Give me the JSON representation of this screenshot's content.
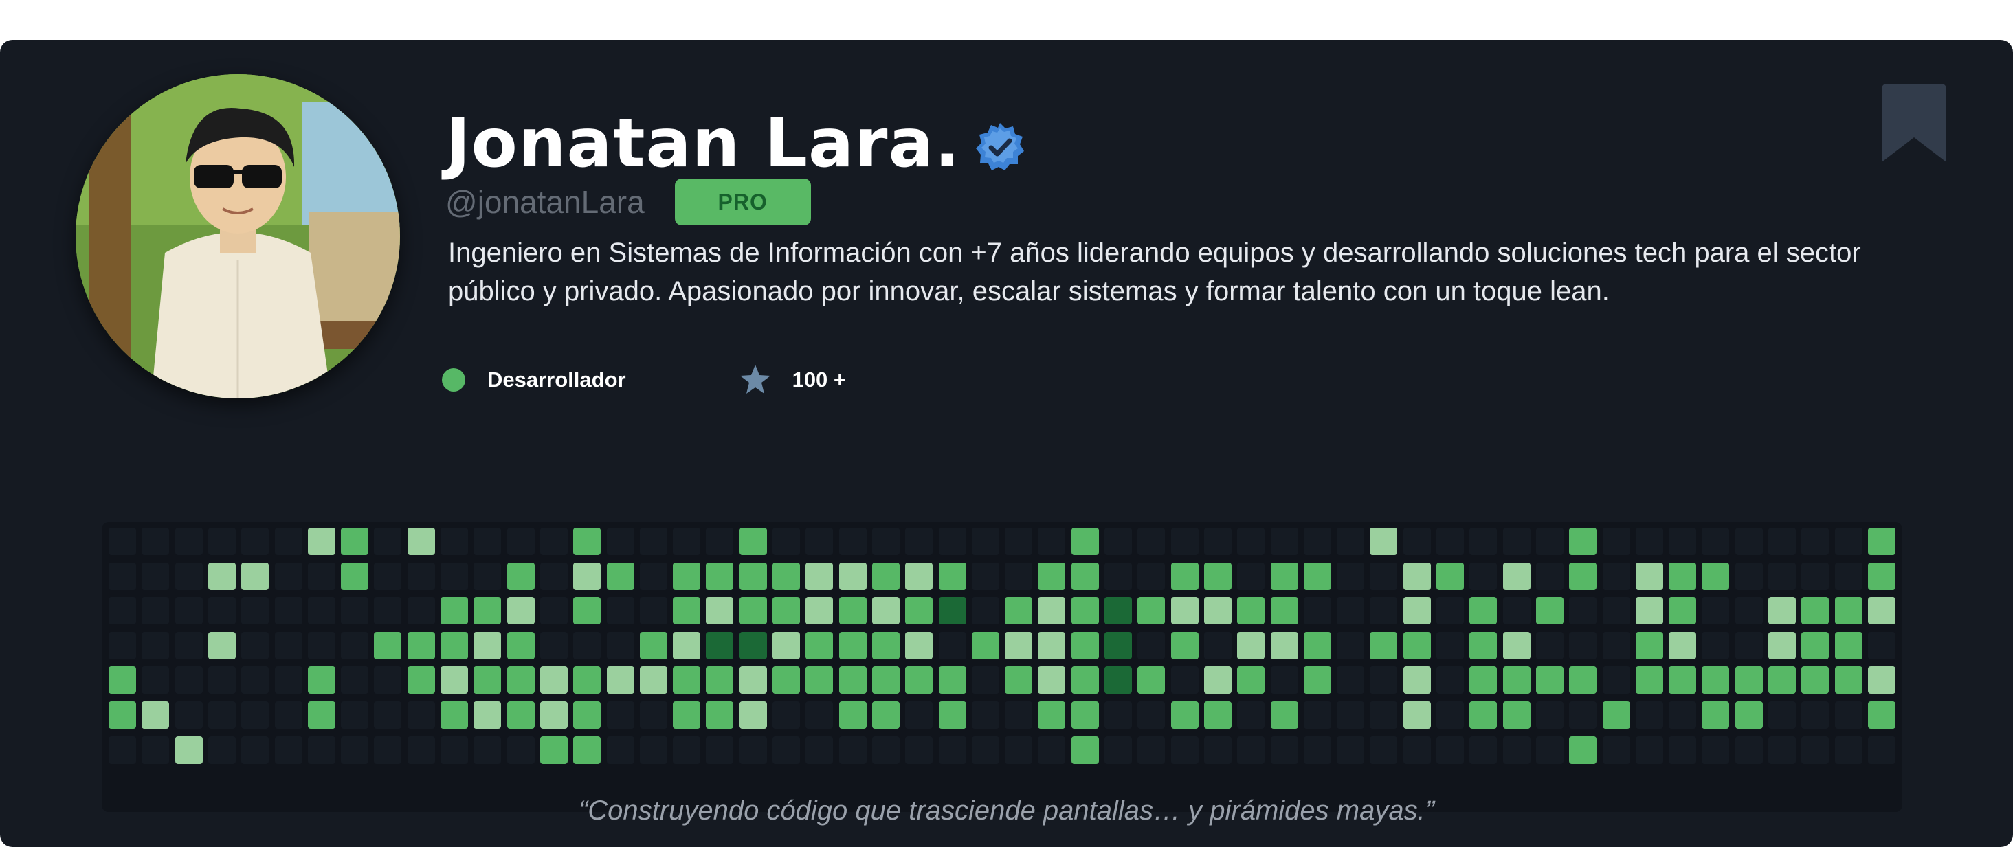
{
  "profile": {
    "name": "Jonatan Lara.",
    "handle": "@jonatanLara",
    "badge": "PRO",
    "bio": "Ingeniero en Sistemas de Información con +7 años liderando equipos y desarrollando soluciones tech para el sector público y privado. Apasionado por innovar, escalar sistemas y formar talento con un toque lean.",
    "role": "Desarrollador",
    "stars": "100 +",
    "quote": "“Construyendo código que trasciende pantallas… y pirámides mayas.”"
  },
  "icons": {
    "verified": "verified-badge-icon",
    "bookmark": "bookmark-icon",
    "status": "status-dot-icon",
    "star": "star-icon"
  },
  "colors": {
    "card_bg": "#151a22",
    "accent_green": "#57b866",
    "pro_bg": "#59b965",
    "pro_text": "#16612c",
    "handle": "#646b75",
    "verified": "#3d83d6",
    "star": "#6c8aa7",
    "bookmark": "#323c4b",
    "contrib_levels": [
      "#151b23",
      "#9bd09e",
      "#57b866",
      "#1b6936"
    ]
  },
  "contributions": {
    "weeks": 54,
    "days": 7,
    "cells": [
      [
        0,
        0,
        0,
        0,
        2,
        2,
        0
      ],
      [
        0,
        0,
        0,
        0,
        0,
        1,
        0
      ],
      [
        0,
        0,
        0,
        0,
        0,
        0,
        1
      ],
      [
        0,
        1,
        0,
        1,
        0,
        0,
        0
      ],
      [
        0,
        1,
        0,
        0,
        0,
        0,
        0
      ],
      [
        0,
        0,
        0,
        0,
        0,
        0,
        0
      ],
      [
        1,
        0,
        0,
        0,
        2,
        2,
        0
      ],
      [
        2,
        2,
        0,
        0,
        0,
        0,
        0
      ],
      [
        0,
        0,
        0,
        2,
        0,
        0,
        0
      ],
      [
        1,
        0,
        0,
        2,
        2,
        0,
        0
      ],
      [
        0,
        0,
        2,
        2,
        1,
        2,
        0
      ],
      [
        0,
        0,
        2,
        1,
        2,
        1,
        0
      ],
      [
        0,
        2,
        1,
        2,
        2,
        2,
        0
      ],
      [
        0,
        0,
        0,
        0,
        1,
        1,
        2
      ],
      [
        2,
        1,
        2,
        0,
        2,
        2,
        2
      ],
      [
        0,
        2,
        0,
        0,
        1,
        0,
        0
      ],
      [
        0,
        0,
        0,
        2,
        1,
        0,
        0
      ],
      [
        0,
        2,
        2,
        1,
        2,
        2,
        0
      ],
      [
        0,
        2,
        1,
        3,
        2,
        2,
        0
      ],
      [
        2,
        2,
        2,
        3,
        1,
        1,
        0
      ],
      [
        0,
        2,
        2,
        1,
        2,
        0,
        0
      ],
      [
        0,
        1,
        1,
        2,
        2,
        0,
        0
      ],
      [
        0,
        1,
        2,
        2,
        2,
        2,
        0
      ],
      [
        0,
        2,
        1,
        2,
        2,
        2,
        0
      ],
      [
        0,
        1,
        2,
        1,
        2,
        0,
        0
      ],
      [
        0,
        2,
        3,
        0,
        2,
        2,
        0
      ],
      [
        0,
        0,
        0,
        2,
        0,
        0,
        0
      ],
      [
        0,
        0,
        2,
        1,
        2,
        0,
        0
      ],
      [
        0,
        2,
        1,
        1,
        1,
        2,
        0
      ],
      [
        2,
        2,
        2,
        2,
        2,
        2,
        2
      ],
      [
        0,
        0,
        3,
        3,
        3,
        0,
        0
      ],
      [
        0,
        0,
        2,
        0,
        2,
        0,
        0
      ],
      [
        0,
        2,
        1,
        2,
        0,
        2,
        0
      ],
      [
        0,
        2,
        1,
        0,
        1,
        2,
        0
      ],
      [
        0,
        0,
        2,
        1,
        2,
        0,
        0
      ],
      [
        0,
        2,
        2,
        1,
        0,
        2,
        0
      ],
      [
        0,
        2,
        0,
        2,
        2,
        0,
        0
      ],
      [
        0,
        0,
        0,
        0,
        0,
        0,
        0
      ],
      [
        1,
        0,
        0,
        2,
        0,
        0,
        0
      ],
      [
        0,
        1,
        1,
        2,
        1,
        1,
        0
      ],
      [
        0,
        2,
        0,
        0,
        0,
        0,
        0
      ],
      [
        0,
        0,
        2,
        2,
        2,
        2,
        0
      ],
      [
        0,
        1,
        0,
        1,
        2,
        2,
        0
      ],
      [
        0,
        0,
        2,
        0,
        2,
        0,
        0
      ],
      [
        2,
        2,
        0,
        0,
        2,
        0,
        2
      ],
      [
        0,
        0,
        0,
        0,
        0,
        2,
        0
      ],
      [
        0,
        1,
        1,
        2,
        2,
        0,
        0
      ],
      [
        0,
        2,
        2,
        1,
        2,
        0,
        0
      ],
      [
        0,
        2,
        0,
        0,
        2,
        2,
        0
      ],
      [
        0,
        0,
        0,
        0,
        2,
        2,
        0
      ],
      [
        0,
        0,
        1,
        1,
        2,
        0,
        0
      ],
      [
        0,
        0,
        2,
        2,
        2,
        0,
        0
      ],
      [
        0,
        0,
        2,
        2,
        2,
        0,
        0
      ],
      [
        2,
        2,
        1,
        0,
        1,
        2,
        0
      ]
    ]
  }
}
